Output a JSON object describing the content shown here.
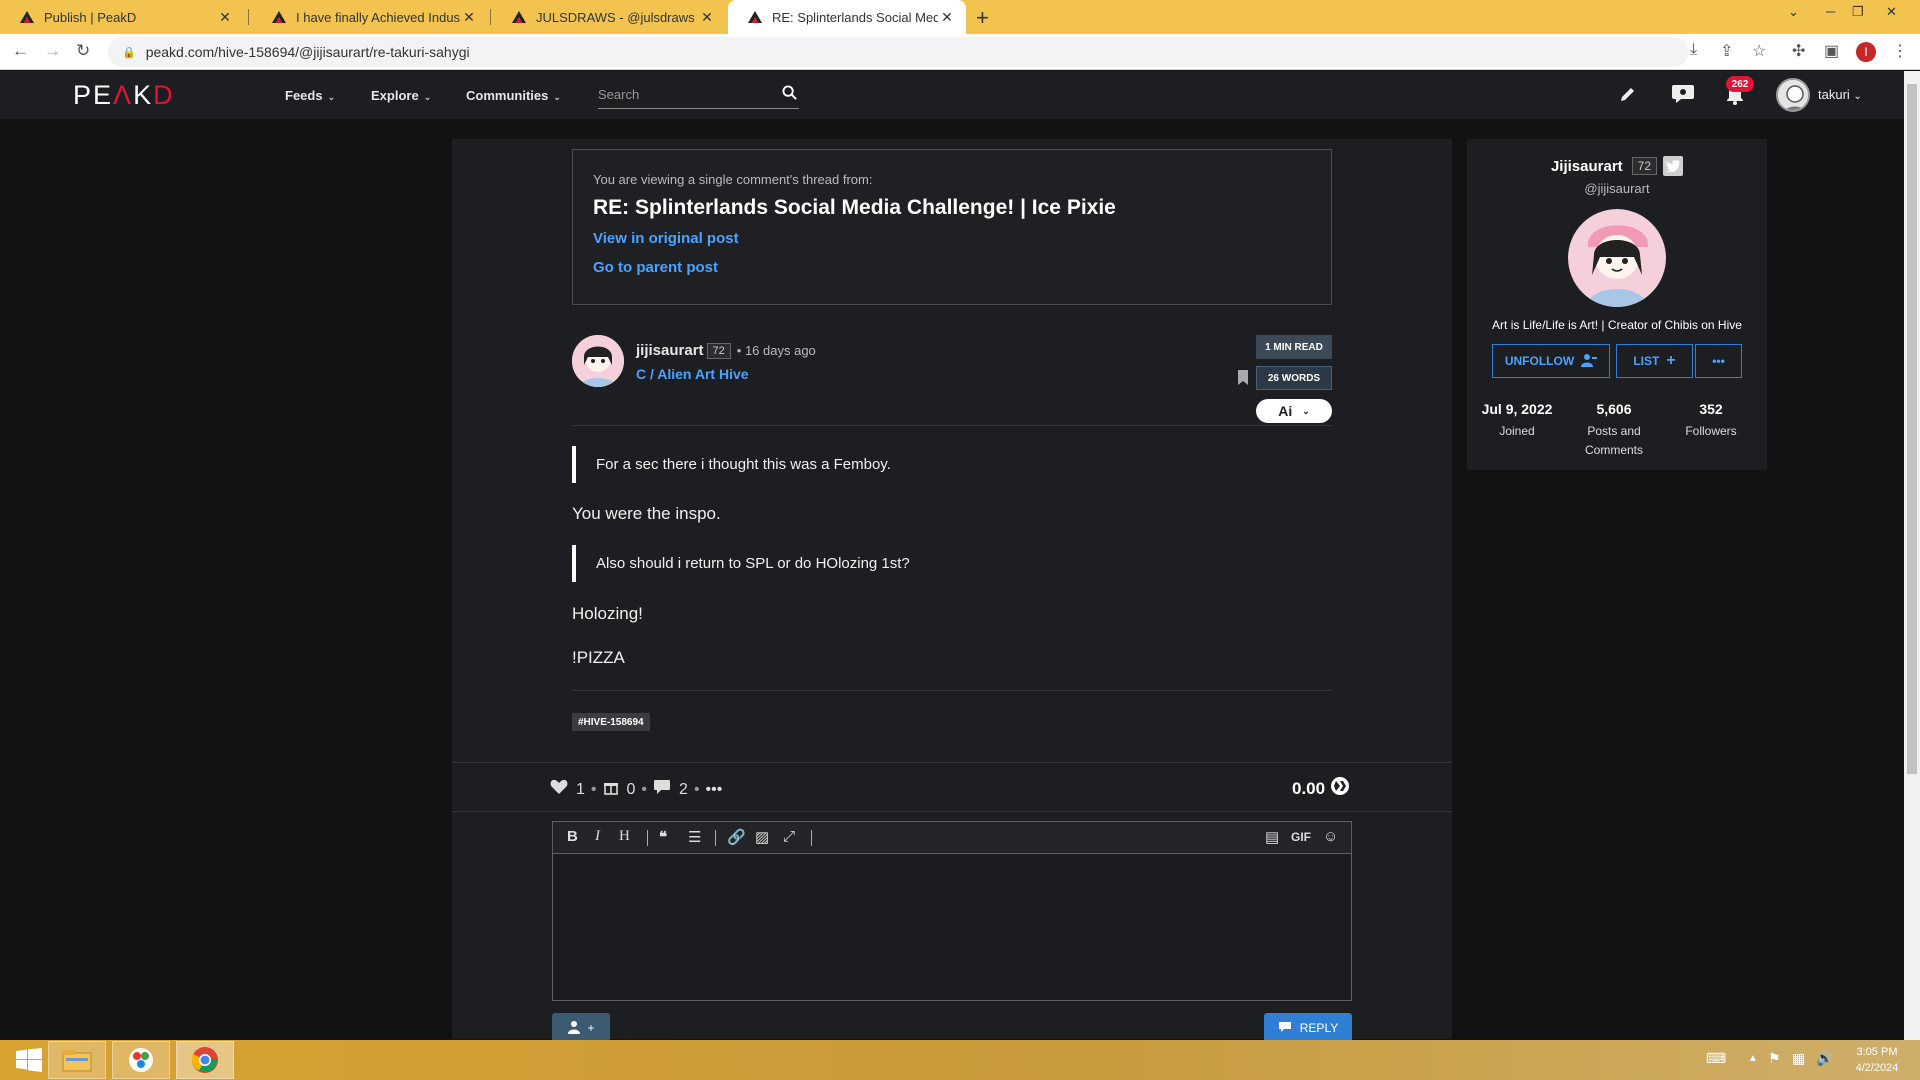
{
  "browser": {
    "tabs": [
      {
        "title": "Publish | PeakD",
        "active": false
      },
      {
        "title": "I have finally Achieved Industry L",
        "active": false
      },
      {
        "title": "JULSDRAWS - @julsdraws | Peak",
        "active": false
      },
      {
        "title": "RE: Splinterlands Social Media Ch",
        "active": true
      }
    ],
    "new_tab": "+",
    "url": "peakd.com/hive-158694/@jijisaurart/re-takuri-sahygi"
  },
  "header": {
    "logo": "PEAKD",
    "nav": [
      {
        "label": "Feeds"
      },
      {
        "label": "Explore"
      },
      {
        "label": "Communities"
      }
    ],
    "search_placeholder": "Search",
    "notification_count": "262",
    "username": "takuri"
  },
  "thread_notice": {
    "intro": "You are viewing a single comment's thread from:",
    "title": "RE: Splinterlands Social Media Challenge! | Ice Pixie",
    "link_original": "View in original post",
    "link_parent": "Go to parent post"
  },
  "comment": {
    "author": "jijisaurart",
    "reputation": "72",
    "time": "• 16 days ago",
    "community": "C / Alien Art Hive",
    "read_time": "1 MIN READ",
    "words": "26 WORDS",
    "language": "Ai",
    "body": {
      "quote1": "For a sec there i thought this was a Femboy.",
      "para1": "You were the inspo.",
      "quote2": "Also should i return to SPL or do HOlozing 1st?",
      "para2": "Holozing!",
      "para3": "!PIZZA"
    },
    "tag": "#HIVE-158694",
    "votes": "1",
    "tips": "0",
    "comments": "2",
    "payout": "0.00"
  },
  "editor": {
    "gif_label": "GIF",
    "reply_label": "REPLY",
    "user_btn_label": "+"
  },
  "profile": {
    "name": "Jijisaurart",
    "reputation": "72",
    "handle": "@jijisaurart",
    "bio": "Art is Life/Life is Art! | Creator of Chibis on Hive",
    "unfollow_label": "UNFOLLOW",
    "list_label": "LIST",
    "more_label": "•••",
    "stats": [
      {
        "value": "Jul 9, 2022",
        "label": "Joined"
      },
      {
        "value": "5,606",
        "label": "Posts and Comments"
      },
      {
        "value": "352",
        "label": "Followers"
      }
    ]
  },
  "taskbar": {
    "time": "3:05 PM",
    "date": "4/2/2024"
  },
  "colors": {
    "accent_link": "#4aa3ff",
    "brand_red": "#e31337",
    "tabbar": "#f2c44f",
    "background": "#111214",
    "card": "#1c1e22"
  }
}
